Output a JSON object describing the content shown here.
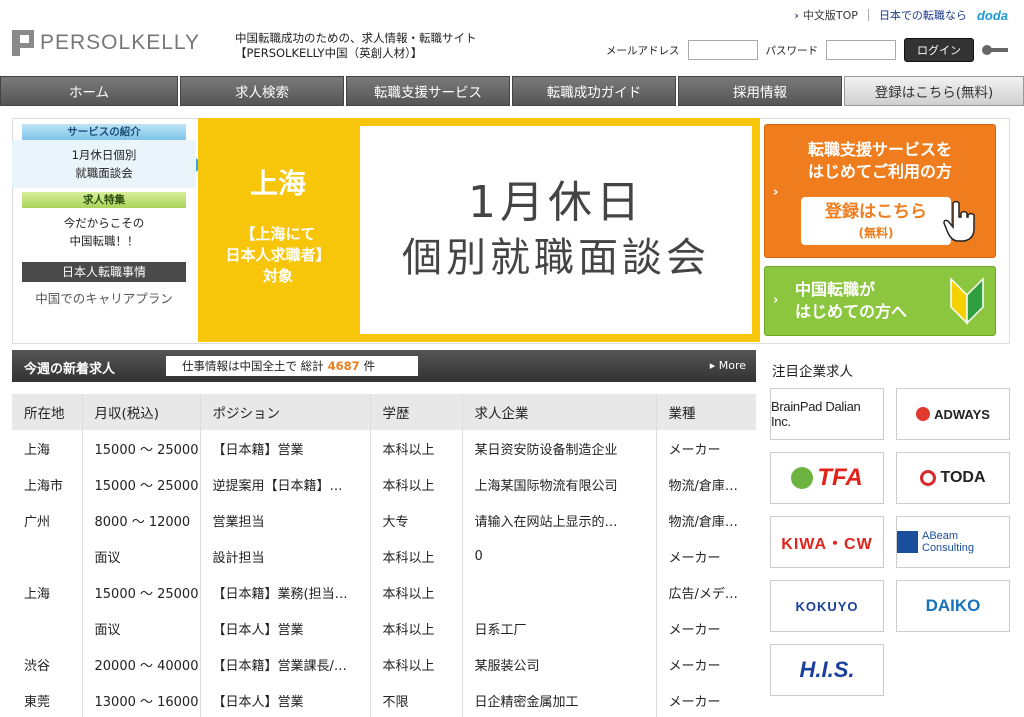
{
  "header": {
    "logo_text": "PERSOLKELLY",
    "tagline_line1": "中国転職成功のための、求人情報・転職サイト",
    "tagline_line2": "【PERSOLKELLY中国（英創人材）】",
    "link_cn_top": "中文版TOP",
    "link_jp": "日本での転職なら",
    "link_doda": "doda",
    "login": {
      "email_label": "メールアドレス",
      "email_value": "",
      "password_label": "パスワード",
      "password_value": "",
      "button_label": "ログイン"
    }
  },
  "nav": {
    "items": [
      "ホーム",
      "求人検索",
      "転職支援サービス",
      "転職成功ガイド",
      "採用情報"
    ],
    "register_label": "登録はこちら(無料)"
  },
  "side_menu": {
    "service_tab": "サービスの紹介",
    "service_item": [
      "1月休日個別",
      "就職面談会"
    ],
    "feature_tab": "求人特集",
    "feature_item": [
      "今だからこその",
      "中国転職！！"
    ],
    "jp_job_label": "日本人転職事情",
    "career_label": "中国でのキャリアプラン"
  },
  "promo": {
    "city": "上海",
    "target_line1": "【上海にて",
    "target_line2": "日本人求職者】",
    "target_line3": "対象",
    "title_line1": "1月休日",
    "title_line2": "個別就職面談会"
  },
  "cta_register": {
    "line1": "転職支援サービスを",
    "line2": "はじめてご利用の方",
    "button_line1": "登録はこちら",
    "button_line2": "(無料)"
  },
  "cta_beginner": {
    "line1": "中国転職が",
    "line2": "はじめての方へ"
  },
  "jobs": {
    "title": "今週の新着求人",
    "count_prefix": "仕事情報は中国全土で 総計",
    "count": "4687",
    "count_suffix": "件",
    "more_label": "More",
    "columns": [
      "所在地",
      "月収(税込)",
      "ポジション",
      "学歴",
      "求人企業",
      "業種"
    ],
    "rows": [
      [
        "上海",
        "15000 ～ 25000",
        "【日本籍】営業",
        "本科以上",
        "某日资安防设备制造企业",
        "メーカー"
      ],
      [
        "上海市",
        "15000 ～ 25000",
        "逆提案用【日本籍】…",
        "本科以上",
        "上海某国际物流有限公司",
        "物流/倉庫…"
      ],
      [
        "广州",
        "8000 ～ 12000",
        "営業担当",
        "大专",
        "请输入在网站上显示的…",
        "物流/倉庫…"
      ],
      [
        "",
        "面议",
        "設計担当",
        "本科以上",
        "0",
        "メーカー"
      ],
      [
        "上海",
        "15000 ～ 25000",
        "【日本籍】業務(担当…",
        "本科以上",
        "",
        "広告/メデ…"
      ],
      [
        "",
        "面议",
        "【日本人】営業",
        "本科以上",
        "日系工厂",
        "メーカー"
      ],
      [
        "渋谷",
        "20000 ～ 40000",
        "【日本籍】営業課長/…",
        "本科以上",
        "某服装公司",
        "メーカー"
      ],
      [
        "東莞",
        "13000 ～ 16000",
        "【日本人】営業",
        "不限",
        "日企精密金属加工",
        "メーカー"
      ]
    ]
  },
  "featured": {
    "title": "注目企業求人",
    "logos": [
      "BrainPad Dalian Inc.",
      "ADWAYS",
      "TFA",
      "TODA",
      "KIWA・CW",
      "ABeam Consulting",
      "KOKUYO",
      "DAIKO",
      "H.I.S."
    ]
  },
  "colors": {
    "accent_orange": "#ef7d1e",
    "accent_green": "#8cc63f",
    "promo_yellow": "#f7c50a",
    "nav_gray": "#555555"
  }
}
